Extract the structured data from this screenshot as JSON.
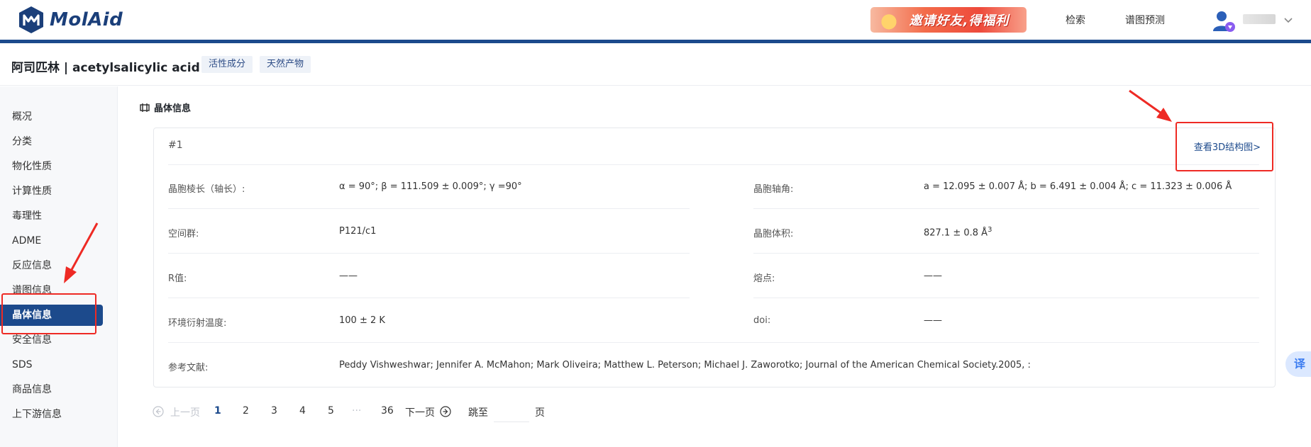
{
  "header": {
    "logo_text": "MolAid",
    "promo_text": "邀请好友,得福利",
    "nav": [
      "检索",
      "谱图预测"
    ]
  },
  "title": {
    "compound": "阿司匹林 | acetylsalicylic acid",
    "tags": [
      "活性成分",
      "天然产物"
    ]
  },
  "sidebar": {
    "items": [
      "概况",
      "分类",
      "物化性质",
      "计算性质",
      "毒理性",
      "ADME",
      "反应信息",
      "谱图信息",
      "晶体信息",
      "安全信息",
      "SDS",
      "商品信息",
      "上下游信息"
    ],
    "active_index": 8
  },
  "section": {
    "title": "晶体信息"
  },
  "card": {
    "id": "#1",
    "link": "查看3D结构图>",
    "fields": [
      {
        "label": "晶胞棱长（轴长）:",
        "value": "α = 90°; β = 111.509 ± 0.009°; γ =90°"
      },
      {
        "label": "晶胞轴角:",
        "value": "a = 12.095 ± 0.007 Å; b = 6.491 ± 0.004 Å; c = 11.323 ± 0.006 Å"
      },
      {
        "label": "空间群:",
        "value": "P121/c1"
      },
      {
        "label": "晶胞体积:",
        "value": "827.1 ± 0.8 Å",
        "sup": "3"
      },
      {
        "label": "R值:",
        "value": "——"
      },
      {
        "label": "熔点:",
        "value": "——"
      },
      {
        "label": "环境衍射温度:",
        "value": "100 ± 2 K"
      },
      {
        "label": "doi:",
        "value": "——"
      }
    ],
    "reference": {
      "label": "参考文献:",
      "value": "Peddy Vishweshwar; Jennifer A. McMahon; Mark Oliveira; Matthew L. Peterson; Michael J. Zaworotko; Journal of the American Chemical Society.2005, :"
    }
  },
  "pagination": {
    "prev": "上一页",
    "pages": [
      "1",
      "2",
      "3",
      "4",
      "5"
    ],
    "ellipsis": "···",
    "last": "36",
    "next": "下一页",
    "jump_label": "跳至",
    "page_suffix": "页",
    "current": "1"
  },
  "translate_button": "译",
  "colors": {
    "brand": "#1c4a8c",
    "annotation": "#ee2a24"
  }
}
